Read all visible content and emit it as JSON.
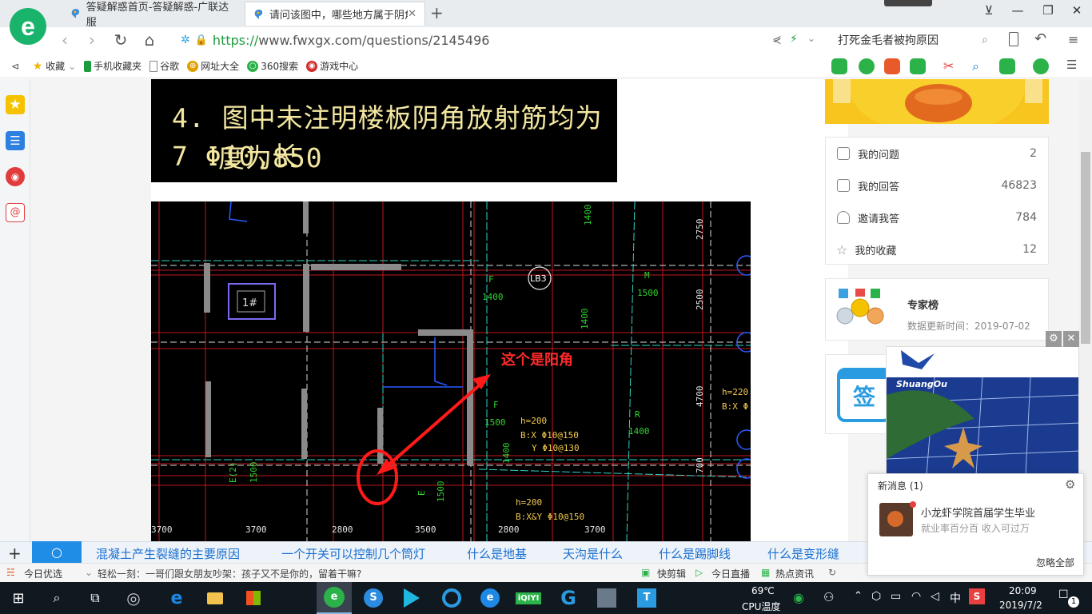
{
  "browser": {
    "tabs": [
      {
        "title": "答疑解惑首页-答疑解惑-广联达服"
      },
      {
        "title": "请问该图中，哪些地方属于阴角？"
      }
    ],
    "url_https": "https://",
    "url_rest": "www.fwxgx.com/questions/2145496",
    "search_text": "打死金毛者被拘原因",
    "bookmarks": [
      "收藏",
      "手机收藏夹",
      "谷歌",
      "网址大全",
      "360搜索",
      "游戏中心"
    ]
  },
  "question": {
    "image1_line1": "4. 图中未注明楼板阴角放射筋均为7 Φ10,长",
    "image1_line2": "度为850",
    "cad_annotation": "这个是阳角",
    "cad_labels": {
      "lb3": "LB3",
      "room": "1#",
      "f1": "F",
      "f1v": "1400",
      "m1": "M",
      "m1v": "1500",
      "h200a": "h=200",
      "bx150": "B:X  Φ10@150",
      "y130": "Y  Φ10@130",
      "f2": "F",
      "f2v": "1500",
      "r1": "R",
      "r1v": "1400",
      "h220": "h=220",
      "bx2": "B:X Φ",
      "h200b": "h=200",
      "bxy150": "B:X&Y  Φ10@150",
      "m2": "M",
      "m2v": "1400",
      "f3": "F",
      "f3v": "1400",
      "e1": "E(2)",
      "e1v": "1500",
      "e2": "E",
      "e2v": "1500",
      "d2750": "2750",
      "d2500": "2500",
      "d4700": "4700",
      "d700": "700",
      "bottom": [
        "3700",
        "3700",
        "2800",
        "3500",
        "2800",
        "3700"
      ]
    }
  },
  "sidebar": {
    "stats": [
      {
        "label": "我的问题",
        "count": "2"
      },
      {
        "label": "我的回答",
        "count": "46823"
      },
      {
        "label": "邀请我答",
        "count": "784"
      },
      {
        "label": "我的收藏",
        "count": "12"
      }
    ],
    "expert_title": "专家榜",
    "expert_sub": "数据更新时间：2019-07-02",
    "sign_text": "签"
  },
  "hot_searches": [
    "混凝土产生裂缝的主要原因",
    "一个开关可以控制几个筒灯",
    "什么是地基",
    "天沟是什么",
    "什么是踢脚线",
    "什么是变形缝"
  ],
  "statusbar": {
    "left": "今日优选",
    "news": "轻松一刻：一哥们跟女朋友吵架：孩子又不是你的，留着干嘛?",
    "items": [
      "快剪辑",
      "今日直播",
      "热点资讯"
    ]
  },
  "ad": {
    "brand": "ShuangOu"
  },
  "notification": {
    "title": "新消息 (1)",
    "msg_title": "小龙虾学院首届学生毕业",
    "msg_sub": "就业率百分百 收入可过万",
    "ignore": "忽略全部"
  },
  "taskbar": {
    "temp": "69℃",
    "temp_label": "CPU温度",
    "ime": "中",
    "time": "20:09",
    "date": "2019/7/2",
    "notif_count": "1"
  }
}
